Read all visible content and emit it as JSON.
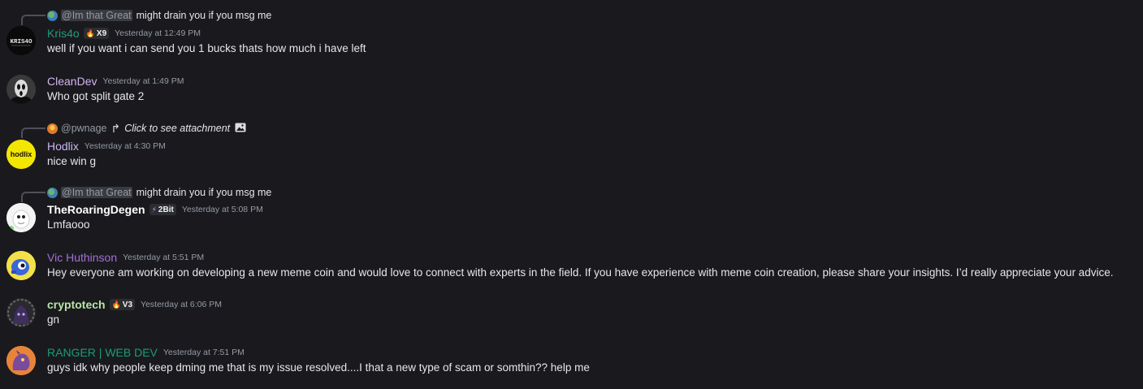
{
  "colors": {
    "background": "#1a1a1e",
    "text": "#e6e7ea",
    "muted": "#949ba4",
    "kris_name": "#1f9d7a",
    "clean_name": "#d3b4f0",
    "hodlix_name": "#c9b8f0",
    "roaring_name": "#ffffff",
    "vic_name": "#a36fd6",
    "crypto_name": "#b7e4a5",
    "ranger_name": "#169e77"
  },
  "messages": [
    {
      "reply": {
        "icon": "globe-avatar-icon",
        "username": "@Im that Great",
        "text": "might drain you if you msg me"
      },
      "avatar_icon": "kris40-logo-avatar",
      "username": "Kris4o",
      "badge": {
        "icon": "flame-icon",
        "label": "X9"
      },
      "timestamp": "Yesterday at 12:49 PM",
      "content": "well if you want i can send you 1 bucks thats how much i have left"
    },
    {
      "avatar_icon": "ghostface-avatar",
      "username": "CleanDev",
      "timestamp": "Yesterday at 1:49 PM",
      "content": "Who got split gate 2"
    },
    {
      "reply": {
        "icon": "orange-avatar-icon",
        "username": "@pwnage",
        "arrow": "↱",
        "text": "Click to see attachment",
        "attachment_icon": "image-icon"
      },
      "avatar_icon": "hodlix-logo-avatar",
      "avatar_text": "hodlix",
      "username": "Hodlix",
      "timestamp": "Yesterday at 4:30 PM",
      "content": "nice win g"
    },
    {
      "reply": {
        "icon": "globe-avatar-icon",
        "username": "@Im that Great",
        "text": "might drain you if you msg me"
      },
      "avatar_icon": "white-creature-avatar",
      "username": "TheRoaringDegen",
      "badge": {
        "icon": "lightning-icon",
        "label": "2Bit"
      },
      "timestamp": "Yesterday at 5:08 PM",
      "content": "Lmfaooo"
    },
    {
      "avatar_icon": "blue-robot-avatar",
      "username": "Vic Huthinson",
      "timestamp": "Yesterday at 5:51 PM",
      "content": "Hey everyone am working on developing a new meme coin and would love to connect with experts in the field. If you have experience with meme coin creation, please share your insights. I’d really appreciate your advice."
    },
    {
      "avatar_icon": "purple-hooded-avatar",
      "username": "cryptotech",
      "badge": {
        "icon": "flame-icon",
        "label": "V3"
      },
      "timestamp": "Yesterday at 6:06 PM",
      "content": "gn"
    },
    {
      "avatar_icon": "purple-dragon-avatar",
      "username": "RANGER | WEB DEV",
      "timestamp": "Yesterday at 7:51 PM",
      "content": "guys idk why people keep dming me that is my issue resolved....I that a new type of scam or somthin?? help me"
    }
  ]
}
